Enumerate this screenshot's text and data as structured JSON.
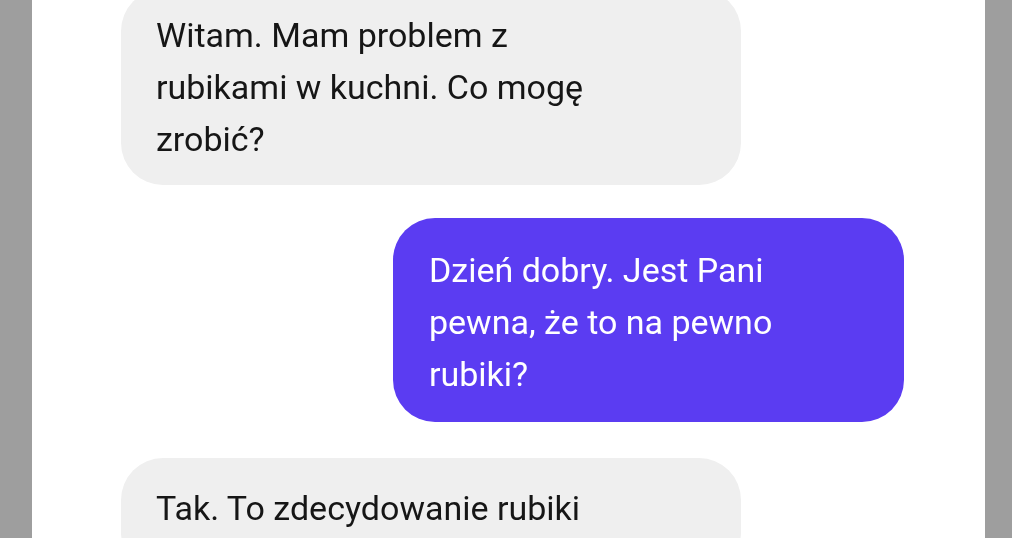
{
  "messages": [
    {
      "kind": "received",
      "text": "Witam. Mam problem z rubikami w kuchni. Co mogę zrobić?"
    },
    {
      "kind": "sent",
      "text": "Dzień dobry. Jest Pani pewna, że to na pewno rubiki?"
    },
    {
      "kind": "received",
      "text": "Tak. To zdecydowanie rubiki"
    }
  ]
}
